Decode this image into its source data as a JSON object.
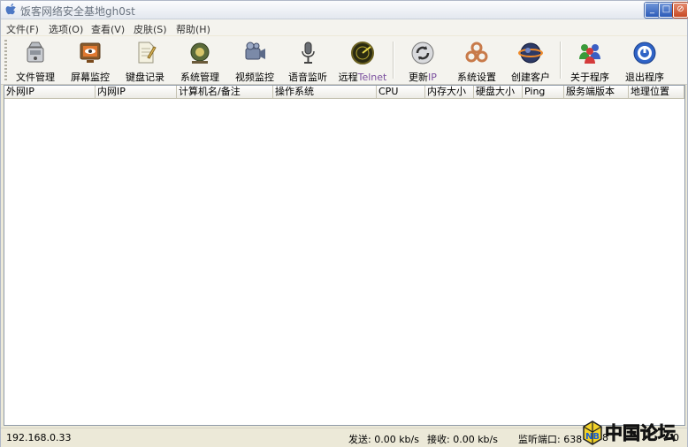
{
  "window": {
    "title": "饭客网络安全基地gh0st",
    "buttons": {
      "minimize": "_",
      "maximize": "□",
      "close": "⊘"
    }
  },
  "menu": [
    {
      "label": "文件(F)"
    },
    {
      "label": "选项(O)"
    },
    {
      "label": "查看(V)"
    },
    {
      "label": "皮肤(S)"
    },
    {
      "label": "帮助(H)"
    }
  ],
  "toolbar": [
    {
      "label": "文件管理",
      "icon": "file-manager-icon"
    },
    {
      "label": "屏幕监控",
      "icon": "screen-monitor-icon"
    },
    {
      "label": "键盘记录",
      "icon": "keylogger-icon"
    },
    {
      "label": "系统管理",
      "icon": "system-manager-icon"
    },
    {
      "label": "视频监控",
      "icon": "video-camera-icon"
    },
    {
      "label": "语音监听",
      "icon": "microphone-icon"
    },
    {
      "label": "远程",
      "label_suffix": "Telnet",
      "icon": "telnet-radar-icon"
    },
    {
      "label": "更新",
      "label_suffix": "IP",
      "icon": "refresh-icon"
    },
    {
      "label": "系统设置",
      "icon": "settings-icon"
    },
    {
      "label": "创建客户",
      "icon": "create-client-icon"
    },
    {
      "label": "关于程序",
      "icon": "users-icon"
    },
    {
      "label": "退出程序",
      "icon": "power-icon"
    }
  ],
  "table": {
    "columns": [
      "外网IP",
      "内网IP",
      "计算机名/备注",
      "操作系统",
      "CPU",
      "内存大小",
      "硬盘大小",
      "Ping",
      "服务端版本",
      "地理位置"
    ],
    "rows": []
  },
  "status": {
    "ip": "192.168.0.33",
    "send": "发送: 0.00 kb/s",
    "recv": "接收: 0.00 kb/s",
    "port": "监听端口: 638",
    "extra": "8",
    "count": "0"
  },
  "watermark": {
    "text": "中国论坛"
  },
  "colors": {
    "accent_purple": "#7a4f9e",
    "titlebar_blue": "#2c5bb8"
  }
}
